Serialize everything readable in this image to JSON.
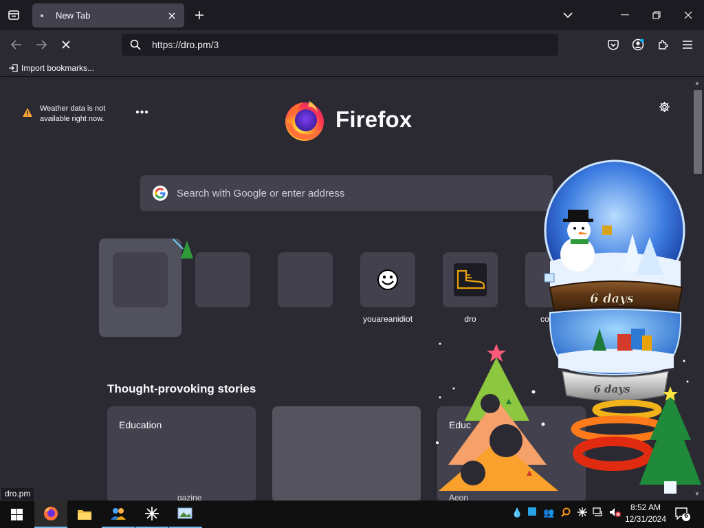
{
  "browser": {
    "tab_title": "New Tab",
    "url_scheme": "https://",
    "url_host": "dro.pm",
    "url_path": "/3",
    "import_bookmarks": "Import bookmarks..."
  },
  "newtab": {
    "weather_text": "Weather data is not available right now.",
    "brand": "Firefox",
    "search_placeholder": "Search with Google or enter address",
    "shortcuts": [
      {
        "label": ""
      },
      {
        "label": ""
      },
      {
        "label": ""
      },
      {
        "label": "youareanidiot"
      },
      {
        "label": "dro"
      },
      {
        "label": "compu"
      }
    ],
    "stories_heading": "Thought-provoking stories",
    "stories": [
      {
        "source": "Education",
        "footer": "gazine"
      },
      {
        "source": "",
        "footer": ""
      },
      {
        "source": "Educ",
        "footer": "Aeon"
      }
    ]
  },
  "status_link": "dro.pm",
  "desktop_toy": {
    "countdown_top": "6 days",
    "countdown_bottom": "6 days"
  },
  "taskbar": {
    "time": "8:52 AM",
    "date": "12/31/2024",
    "notification_count": "6"
  },
  "colors": {
    "chrome_dark": "#1c1b22",
    "page_bg": "#2b2a33",
    "tile_bg": "#42414d",
    "accent": "#76b9ed"
  }
}
